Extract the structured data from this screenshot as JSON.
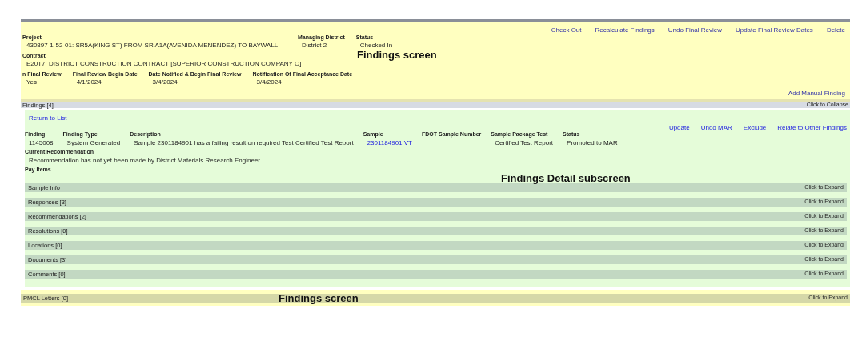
{
  "header": {
    "actions": [
      "Check Out",
      "Recalculate Findings",
      "Undo Final Review",
      "Update Final Review Dates",
      "Delete"
    ],
    "project_line": [
      {
        "label": "Project",
        "value": "430897-1-52-01: SR5A(KING ST) FROM SR A1A(AVENIDA MENENDEZ) TO BAYWALL"
      },
      {
        "label": "Managing District",
        "value": "District 2"
      },
      {
        "label": "Status",
        "value": "Checked In"
      }
    ],
    "contract_line": [
      {
        "label": "Contract",
        "value": "E20T7: DISTRICT CONSTRUCTION CONTRACT [SUPERIOR CONSTRUCTION COMPANY O]"
      }
    ],
    "review_line": [
      {
        "label": "n Final Review",
        "value": "Yes"
      },
      {
        "label": "Final Review Begin Date",
        "value": "4/1/2024"
      },
      {
        "label": "Date Notified & Begin Final Review",
        "value": "3/4/2024"
      },
      {
        "label": "Notification Of Final Acceptance Date",
        "value": "3/4/2024"
      }
    ],
    "add_link": "Add Manual Finding",
    "caption": "Findings screen"
  },
  "findings_bar": {
    "title": "Findings [4]",
    "toggle": "Click to Collapse"
  },
  "detail": {
    "return_link": "Return to List",
    "caption": "Findings Detail subscreen",
    "actions": [
      "Update",
      "Undo MAR",
      "Exclude",
      "Relate to Other Findings"
    ],
    "fields": [
      {
        "label": "Finding",
        "value": "1145008",
        "link": false
      },
      {
        "label": "Finding Type",
        "value": "System Generated",
        "link": false
      },
      {
        "label": "Description",
        "value": "Sample 2301184901 has a failing result on required Test Certified Test Report",
        "link": false
      },
      {
        "label": "Sample",
        "value": "2301184901 VT",
        "link": true
      },
      {
        "label": "FDOT Sample Number"
      },
      {
        "label": "Sample Package Test",
        "value": "Certified Test Report",
        "link": false
      },
      {
        "label": "Status",
        "value": "Promoted to MAR",
        "link": false
      }
    ],
    "recommendation": {
      "label": "Current Recommendation",
      "value": "Recommendation has not yet been made by District Materials Research Engineer"
    },
    "pay_items_label": "Pay Items",
    "sections": [
      {
        "title": "Sample Info",
        "toggle": "Click to Expand"
      },
      {
        "title": "Responses [3]",
        "toggle": "Click to Expand"
      },
      {
        "title": "Recommendations [2]",
        "toggle": "Click to Expand"
      },
      {
        "title": "Resolutions [0]",
        "toggle": "Click to Expand"
      },
      {
        "title": "Locations [0]",
        "toggle": "Click to Expand"
      },
      {
        "title": "Documents [3]",
        "toggle": "Click to Expand"
      },
      {
        "title": "Comments [0]",
        "toggle": "Click to Expand"
      }
    ]
  },
  "footer_bar": {
    "title": "PMCL Letters [0]",
    "toggle": "Click to Expand",
    "caption": "Findings screen"
  }
}
